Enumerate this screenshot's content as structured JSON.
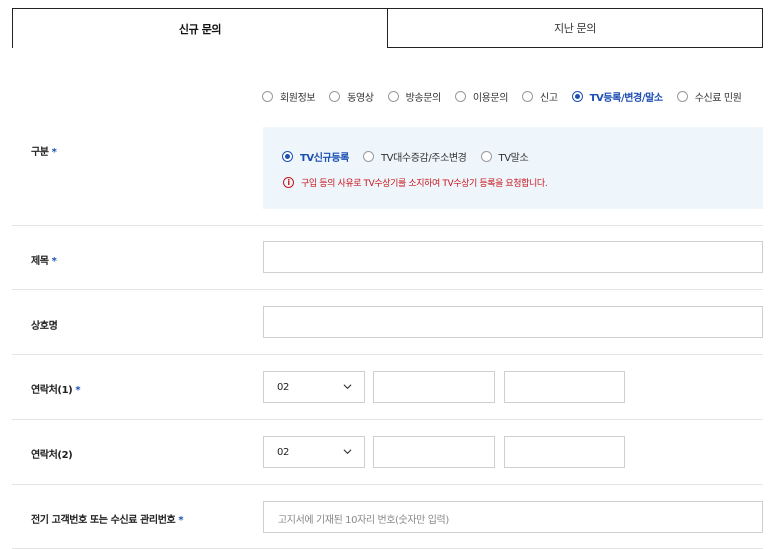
{
  "tabs": {
    "new": "신규 문의",
    "past": "지난 문의"
  },
  "category": {
    "label": "구분",
    "required_mark": "*",
    "options": [
      "회원정보",
      "동영상",
      "방송문의",
      "이용문의",
      "신고",
      "TV등록/변경/말소",
      "수신료 민원"
    ],
    "selected_index": 5,
    "sub_options": [
      "TV신규등록",
      "TV대수증감/주소변경",
      "TV말소"
    ],
    "sub_selected_index": 0,
    "warning_icon": "i",
    "warning": "구입 등의 사유로 TV수상기를 소지하여 TV수상기 등록을 요청합니다."
  },
  "title": {
    "label": "제목",
    "required_mark": "*",
    "value": ""
  },
  "company": {
    "label": "상호명",
    "value": ""
  },
  "phone1": {
    "label": "연락처(1)",
    "required_mark": "*",
    "area_code": "02",
    "mid": "",
    "last": ""
  },
  "phone2": {
    "label": "연락처(2)",
    "area_code": "02",
    "mid": "",
    "last": ""
  },
  "customer_no": {
    "label": "전기 고객번호 또는 수신료 관리번호",
    "required_mark": "*",
    "placeholder": "고지서에 기재된 10자리 번호(숫자만 입력)"
  },
  "colors": {
    "accent": "#1e4fb3",
    "warning": "#c8161d",
    "sub_box_bg": "#eef6fb"
  }
}
